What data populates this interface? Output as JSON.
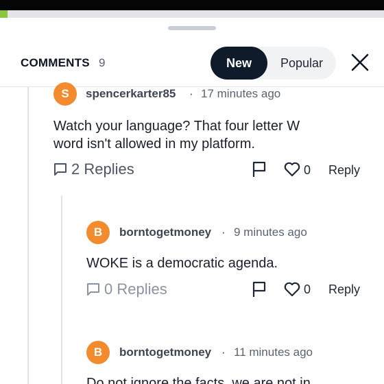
{
  "status_bar": {
    "progress_fraction": 0.02,
    "accent": "#8cc63f"
  },
  "header": {
    "title": "COMMENTS",
    "count": "9",
    "sort_tabs": [
      {
        "label": "New",
        "selected": true
      },
      {
        "label": "Popular",
        "selected": false
      }
    ],
    "close_icon": "close-icon"
  },
  "comments": [
    {
      "avatar_letter": "S",
      "username": "spencerkarter85",
      "separator": "·",
      "time": "17 minutes ago",
      "text_lines": [
        "Watch your language? That four letter W",
        "word isn't allowed in my platform."
      ],
      "replies_label": "2 Replies",
      "likes": "0",
      "reply_label": "Reply"
    },
    {
      "avatar_letter": "B",
      "username": "borntogetmoney",
      "separator": "·",
      "time": "9 minutes ago",
      "text_lines": [
        "WOKE is a democratic agenda."
      ],
      "replies_label": "0 Replies",
      "likes": "0",
      "reply_label": "Reply"
    },
    {
      "avatar_letter": "B",
      "username": "borntogetmoney",
      "separator": "·",
      "time": "11 minutes ago",
      "text_lines": [
        "Do not ignore the facts, we are not in"
      ]
    }
  ],
  "colors": {
    "avatar": "#f28a2e",
    "selected_tab": "#0f1b2a"
  }
}
